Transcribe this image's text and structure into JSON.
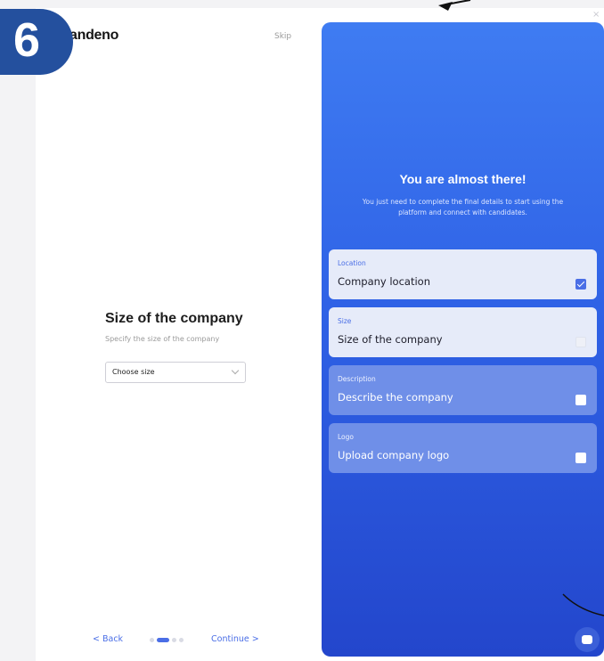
{
  "step_badge": "6",
  "left": {
    "logo": "andeno",
    "skip": "Skip",
    "form_title": "Size of the company",
    "form_subtitle": "Specify the size of the company",
    "select_placeholder": "Choose size",
    "back": "< Back",
    "continue": "Continue >",
    "progress_step": 2,
    "progress_total": 4
  },
  "panel": {
    "title": "You are almost there!",
    "subtitle": "You just need to complete the final details to start using the platform and connect with candidates.",
    "cards": [
      {
        "caption": "Location",
        "title": "Company location",
        "checked": true
      },
      {
        "caption": "Size",
        "title": "Size of the company",
        "checked": false
      },
      {
        "caption": "Description",
        "title": "Describe the company",
        "checked": false
      },
      {
        "caption": "Logo",
        "title": "Upload company logo",
        "checked": false
      }
    ]
  },
  "close": "×"
}
